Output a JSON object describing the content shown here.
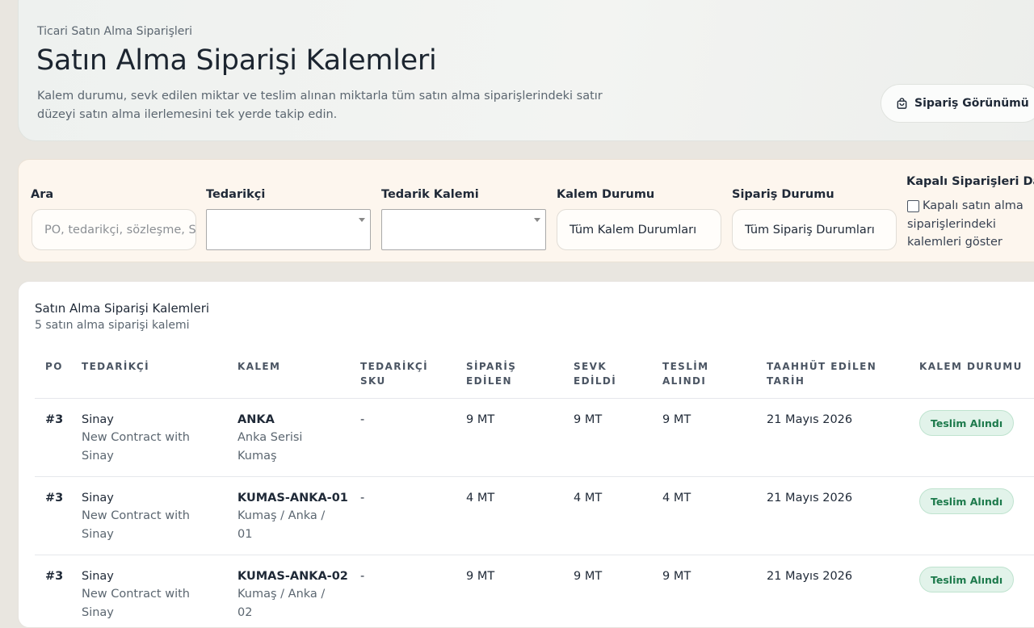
{
  "header": {
    "eyebrow": "Ticari Satın Alma Siparişleri",
    "title": "Satın Alma Siparişi Kalemleri",
    "description": "Kalem durumu, sevk edilen miktar ve teslim alınan miktarla tüm satın alma siparişlerindeki satır düzeyi satın alma ilerlemesini tek yerde takip edin.",
    "order_view_button": "Sipariş Görünümü",
    "order_view_icon": "shopping-bag-icon"
  },
  "filters": {
    "search": {
      "label": "Ara",
      "placeholder": "PO, tedarikçi, sözleşme, SKU"
    },
    "supplier": {
      "label": "Tedarikçi",
      "value": ""
    },
    "supply_item": {
      "label": "Tedarik Kalemi",
      "value": ""
    },
    "item_status": {
      "label": "Kalem Durumu",
      "value": "Tüm Kalem Durumları"
    },
    "order_status": {
      "label": "Sipariş Durumu",
      "value": "Tüm Sipariş Durumları"
    },
    "closed_orders": {
      "label": "Kapalı Siparişleri Dahil Et",
      "text": "Kapalı satın alma siparişlerindeki kalemleri göster",
      "checked": false
    }
  },
  "table": {
    "title": "Satın Alma Siparişi Kalemleri",
    "count": "5 satın alma siparişi kalemi",
    "columns": [
      "PO",
      "TEDARİKÇİ",
      "KALEM",
      "TEDARİKÇİ SKU",
      "SİPARİŞ EDİLEN",
      "SEVK EDİLDİ",
      "TESLİM ALINDI",
      "TAAHHÜT EDİLEN TARİH",
      "KALEM DURUMU"
    ],
    "rows": [
      {
        "po": "#3",
        "supplier": "Sinay",
        "contract": "New Contract with Sinay",
        "item_code": "ANKA",
        "item_desc": "Anka Serisi Kumaş",
        "sku": "-",
        "ordered": "9 MT",
        "shipped": "9 MT",
        "received": "9 MT",
        "date": "21 Mayıs 2026",
        "status": "Teslim Alındı"
      },
      {
        "po": "#3",
        "supplier": "Sinay",
        "contract": "New Contract with Sinay",
        "item_code": "KUMAS-ANKA-01",
        "item_desc": "Kumaş / Anka / 01",
        "sku": "-",
        "ordered": "4 MT",
        "shipped": "4 MT",
        "received": "4 MT",
        "date": "21 Mayıs 2026",
        "status": "Teslim Alındı"
      },
      {
        "po": "#3",
        "supplier": "Sinay",
        "contract": "New Contract with Sinay",
        "item_code": "KUMAS-ANKA-02",
        "item_desc": "Kumaş / Anka / 02",
        "sku": "-",
        "ordered": "9 MT",
        "shipped": "9 MT",
        "received": "9 MT",
        "date": "21 Mayıs 2026",
        "status": "Teslim Alındı"
      }
    ]
  },
  "colors": {
    "accent_green": "#1d7a4c",
    "badge_bg": "#e2f3ea",
    "filter_bg": "#fdf6ee",
    "page_bg": "#e9e6e0"
  }
}
